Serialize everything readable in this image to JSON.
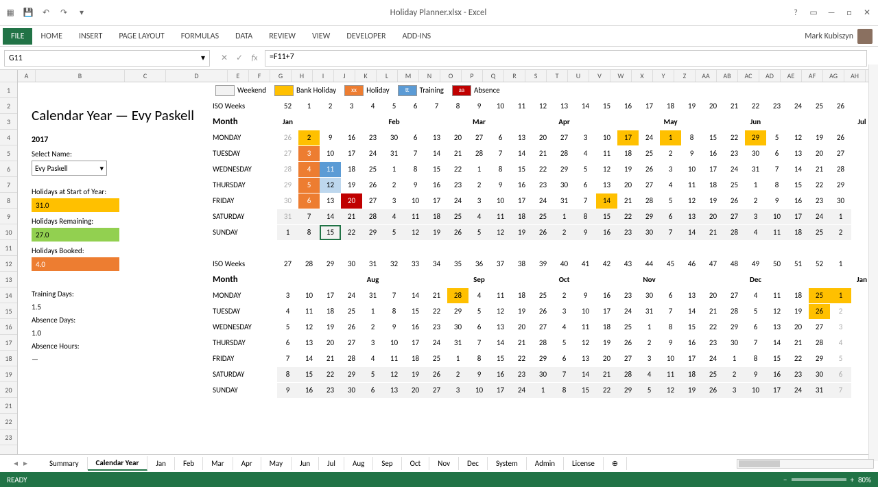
{
  "app": {
    "title": "Holiday Planner.xlsx - Excel"
  },
  "user": {
    "name": "Mark Kubiszyn"
  },
  "ribbon": [
    "FILE",
    "HOME",
    "INSERT",
    "PAGE LAYOUT",
    "FORMULAS",
    "DATA",
    "REVIEW",
    "VIEW",
    "DEVELOPER",
    "ADD-INS"
  ],
  "name_box": "G11",
  "formula": "=F11+7",
  "legend": {
    "weekend": "Weekend",
    "bank": "Bank Holiday",
    "holiday": "Holiday",
    "training": "Training",
    "absence": "Absence",
    "xx": "xx",
    "tt": "tt",
    "aa": "aa"
  },
  "sidebar": {
    "title": "Calendar Year — Evy Paskell",
    "year": "2017",
    "select_label": "Select Name:",
    "select_value": "Evy Paskell",
    "holidays_start_label": "Holidays at Start of Year:",
    "holidays_start": "31.0",
    "holidays_remaining_label": "Holidays Remaining:",
    "holidays_remaining": "27.0",
    "holidays_booked_label": "Holidays Booked:",
    "holidays_booked": "4.0",
    "training_label": "Training Days:",
    "training": "1.5",
    "absence_days_label": "Absence Days:",
    "absence_days": "1.0",
    "absence_hours_label": "Absence Hours:",
    "absence_hours": "—"
  },
  "iso_label": "ISO Weeks",
  "month_label": "Month",
  "months1": {
    "Jan": 0,
    "Feb": 5,
    "Mar": 9,
    "Apr": 13,
    "May": 18,
    "Jun": 22,
    "Jul": 27
  },
  "months2": {
    "Aug": 4,
    "Sep": 9,
    "Oct": 13,
    "Nov": 17,
    "Dec": 22,
    "Jan": 27
  },
  "iso1": [
    "52",
    "1",
    "2",
    "3",
    "4",
    "5",
    "6",
    "7",
    "8",
    "9",
    "10",
    "11",
    "12",
    "13",
    "14",
    "15",
    "16",
    "17",
    "18",
    "19",
    "20",
    "21",
    "22",
    "23",
    "24",
    "25",
    "26"
  ],
  "iso2": [
    "27",
    "28",
    "29",
    "30",
    "31",
    "32",
    "33",
    "34",
    "35",
    "36",
    "37",
    "38",
    "39",
    "40",
    "41",
    "42",
    "43",
    "44",
    "45",
    "46",
    "47",
    "48",
    "49",
    "50",
    "51",
    "52",
    "1"
  ],
  "days": [
    "MONDAY",
    "TUESDAY",
    "WEDNESDAY",
    "THURSDAY",
    "FRIDAY",
    "SATURDAY",
    "SUNDAY"
  ],
  "block1": [
    [
      [
        "26",
        "gray"
      ],
      [
        "2",
        "hol-yellow"
      ],
      [
        "9",
        ""
      ],
      [
        "16",
        ""
      ],
      [
        "23",
        ""
      ],
      [
        "30",
        ""
      ],
      [
        "6",
        ""
      ],
      [
        "13",
        ""
      ],
      [
        "20",
        ""
      ],
      [
        "27",
        ""
      ],
      [
        "6",
        ""
      ],
      [
        "13",
        ""
      ],
      [
        "20",
        ""
      ],
      [
        "27",
        ""
      ],
      [
        "3",
        ""
      ],
      [
        "10",
        ""
      ],
      [
        "17",
        "hol-yellow"
      ],
      [
        "24",
        ""
      ],
      [
        "1",
        "hol-yellow"
      ],
      [
        "8",
        ""
      ],
      [
        "15",
        ""
      ],
      [
        "22",
        ""
      ],
      [
        "29",
        "hol-yellow"
      ],
      [
        "5",
        ""
      ],
      [
        "12",
        ""
      ],
      [
        "19",
        ""
      ],
      [
        "26",
        ""
      ]
    ],
    [
      [
        "27",
        "gray"
      ],
      [
        "3",
        "hol-orange"
      ],
      [
        "10",
        ""
      ],
      [
        "17",
        ""
      ],
      [
        "24",
        ""
      ],
      [
        "31",
        ""
      ],
      [
        "7",
        ""
      ],
      [
        "14",
        ""
      ],
      [
        "21",
        ""
      ],
      [
        "28",
        ""
      ],
      [
        "7",
        ""
      ],
      [
        "14",
        ""
      ],
      [
        "21",
        ""
      ],
      [
        "28",
        ""
      ],
      [
        "4",
        ""
      ],
      [
        "11",
        ""
      ],
      [
        "18",
        ""
      ],
      [
        "25",
        ""
      ],
      [
        "2",
        ""
      ],
      [
        "9",
        ""
      ],
      [
        "16",
        ""
      ],
      [
        "23",
        ""
      ],
      [
        "30",
        ""
      ],
      [
        "6",
        ""
      ],
      [
        "13",
        ""
      ],
      [
        "20",
        ""
      ],
      [
        "27",
        ""
      ]
    ],
    [
      [
        "28",
        "gray"
      ],
      [
        "4",
        "hol-orange"
      ],
      [
        "11",
        "hol-blue"
      ],
      [
        "18",
        ""
      ],
      [
        "25",
        ""
      ],
      [
        "1",
        ""
      ],
      [
        "8",
        ""
      ],
      [
        "15",
        ""
      ],
      [
        "22",
        ""
      ],
      [
        "1",
        ""
      ],
      [
        "8",
        ""
      ],
      [
        "15",
        ""
      ],
      [
        "22",
        ""
      ],
      [
        "29",
        ""
      ],
      [
        "5",
        ""
      ],
      [
        "12",
        ""
      ],
      [
        "19",
        ""
      ],
      [
        "26",
        ""
      ],
      [
        "3",
        ""
      ],
      [
        "10",
        ""
      ],
      [
        "17",
        ""
      ],
      [
        "24",
        ""
      ],
      [
        "31",
        ""
      ],
      [
        "7",
        ""
      ],
      [
        "14",
        ""
      ],
      [
        "21",
        ""
      ],
      [
        "28",
        ""
      ]
    ],
    [
      [
        "29",
        "gray"
      ],
      [
        "5",
        "hol-orange"
      ],
      [
        "12",
        "hol-lblue"
      ],
      [
        "19",
        ""
      ],
      [
        "26",
        ""
      ],
      [
        "2",
        ""
      ],
      [
        "9",
        ""
      ],
      [
        "16",
        ""
      ],
      [
        "23",
        ""
      ],
      [
        "2",
        ""
      ],
      [
        "9",
        ""
      ],
      [
        "16",
        ""
      ],
      [
        "23",
        ""
      ],
      [
        "30",
        ""
      ],
      [
        "6",
        ""
      ],
      [
        "13",
        ""
      ],
      [
        "20",
        ""
      ],
      [
        "27",
        ""
      ],
      [
        "4",
        ""
      ],
      [
        "11",
        ""
      ],
      [
        "18",
        ""
      ],
      [
        "25",
        ""
      ],
      [
        "1",
        ""
      ],
      [
        "8",
        ""
      ],
      [
        "15",
        ""
      ],
      [
        "22",
        ""
      ],
      [
        "29",
        ""
      ]
    ],
    [
      [
        "30",
        "gray"
      ],
      [
        "6",
        "hol-orange"
      ],
      [
        "13",
        ""
      ],
      [
        "20",
        "hol-red"
      ],
      [
        "27",
        ""
      ],
      [
        "3",
        ""
      ],
      [
        "10",
        ""
      ],
      [
        "17",
        ""
      ],
      [
        "24",
        ""
      ],
      [
        "3",
        ""
      ],
      [
        "10",
        ""
      ],
      [
        "17",
        ""
      ],
      [
        "24",
        ""
      ],
      [
        "31",
        ""
      ],
      [
        "7",
        ""
      ],
      [
        "14",
        "hol-yellow"
      ],
      [
        "21",
        ""
      ],
      [
        "28",
        ""
      ],
      [
        "5",
        ""
      ],
      [
        "12",
        ""
      ],
      [
        "19",
        ""
      ],
      [
        "26",
        ""
      ],
      [
        "2",
        ""
      ],
      [
        "9",
        ""
      ],
      [
        "16",
        ""
      ],
      [
        "23",
        ""
      ],
      [
        "30",
        ""
      ]
    ],
    [
      [
        "31",
        "gray weekend"
      ],
      [
        "7",
        "weekend"
      ],
      [
        "14",
        "weekend"
      ],
      [
        "21",
        "weekend"
      ],
      [
        "28",
        "weekend"
      ],
      [
        "4",
        "weekend"
      ],
      [
        "11",
        "weekend"
      ],
      [
        "18",
        "weekend"
      ],
      [
        "25",
        "weekend"
      ],
      [
        "4",
        "weekend"
      ],
      [
        "11",
        "weekend"
      ],
      [
        "18",
        "weekend"
      ],
      [
        "25",
        "weekend"
      ],
      [
        "1",
        "weekend"
      ],
      [
        "8",
        "weekend"
      ],
      [
        "15",
        "weekend"
      ],
      [
        "22",
        "weekend"
      ],
      [
        "29",
        "weekend"
      ],
      [
        "6",
        "weekend"
      ],
      [
        "13",
        "weekend"
      ],
      [
        "20",
        "weekend"
      ],
      [
        "27",
        "weekend"
      ],
      [
        "3",
        "weekend"
      ],
      [
        "10",
        "weekend"
      ],
      [
        "17",
        "weekend"
      ],
      [
        "24",
        "weekend"
      ],
      [
        "1",
        "weekend"
      ]
    ],
    [
      [
        "1",
        "weekend"
      ],
      [
        "8",
        "weekend"
      ],
      [
        "15",
        "weekend selected"
      ],
      [
        "22",
        "weekend"
      ],
      [
        "29",
        "weekend"
      ],
      [
        "5",
        "weekend"
      ],
      [
        "12",
        "weekend"
      ],
      [
        "19",
        "weekend"
      ],
      [
        "26",
        "weekend"
      ],
      [
        "5",
        "weekend"
      ],
      [
        "12",
        "weekend"
      ],
      [
        "19",
        "weekend"
      ],
      [
        "26",
        "weekend"
      ],
      [
        "2",
        "weekend"
      ],
      [
        "9",
        "weekend"
      ],
      [
        "16",
        "weekend"
      ],
      [
        "23",
        "weekend"
      ],
      [
        "30",
        "weekend"
      ],
      [
        "7",
        "weekend"
      ],
      [
        "14",
        "weekend"
      ],
      [
        "21",
        "weekend"
      ],
      [
        "28",
        "weekend"
      ],
      [
        "4",
        "weekend"
      ],
      [
        "11",
        "weekend"
      ],
      [
        "18",
        "weekend"
      ],
      [
        "25",
        "weekend"
      ],
      [
        "2",
        "weekend"
      ]
    ]
  ],
  "block2": [
    [
      [
        "3",
        ""
      ],
      [
        "10",
        ""
      ],
      [
        "17",
        ""
      ],
      [
        "24",
        ""
      ],
      [
        "31",
        ""
      ],
      [
        "7",
        ""
      ],
      [
        "14",
        ""
      ],
      [
        "21",
        ""
      ],
      [
        "28",
        "hol-yellow"
      ],
      [
        "4",
        ""
      ],
      [
        "11",
        ""
      ],
      [
        "18",
        ""
      ],
      [
        "25",
        ""
      ],
      [
        "2",
        ""
      ],
      [
        "9",
        ""
      ],
      [
        "16",
        ""
      ],
      [
        "23",
        ""
      ],
      [
        "30",
        ""
      ],
      [
        "6",
        ""
      ],
      [
        "13",
        ""
      ],
      [
        "20",
        ""
      ],
      [
        "27",
        ""
      ],
      [
        "4",
        ""
      ],
      [
        "11",
        ""
      ],
      [
        "18",
        ""
      ],
      [
        "25",
        "hol-yellow"
      ],
      [
        "1",
        "hol-yellow"
      ]
    ],
    [
      [
        "4",
        ""
      ],
      [
        "11",
        ""
      ],
      [
        "18",
        ""
      ],
      [
        "25",
        ""
      ],
      [
        "1",
        ""
      ],
      [
        "8",
        ""
      ],
      [
        "15",
        ""
      ],
      [
        "22",
        ""
      ],
      [
        "29",
        ""
      ],
      [
        "5",
        ""
      ],
      [
        "12",
        ""
      ],
      [
        "19",
        ""
      ],
      [
        "26",
        ""
      ],
      [
        "3",
        ""
      ],
      [
        "10",
        ""
      ],
      [
        "17",
        ""
      ],
      [
        "24",
        ""
      ],
      [
        "31",
        ""
      ],
      [
        "7",
        ""
      ],
      [
        "14",
        ""
      ],
      [
        "21",
        ""
      ],
      [
        "28",
        ""
      ],
      [
        "5",
        ""
      ],
      [
        "12",
        ""
      ],
      [
        "19",
        ""
      ],
      [
        "26",
        "hol-yellow"
      ],
      [
        "2",
        "gray"
      ]
    ],
    [
      [
        "5",
        ""
      ],
      [
        "12",
        ""
      ],
      [
        "19",
        ""
      ],
      [
        "26",
        ""
      ],
      [
        "2",
        ""
      ],
      [
        "9",
        ""
      ],
      [
        "16",
        ""
      ],
      [
        "23",
        ""
      ],
      [
        "30",
        ""
      ],
      [
        "6",
        ""
      ],
      [
        "13",
        ""
      ],
      [
        "20",
        ""
      ],
      [
        "27",
        ""
      ],
      [
        "4",
        ""
      ],
      [
        "11",
        ""
      ],
      [
        "18",
        ""
      ],
      [
        "25",
        ""
      ],
      [
        "1",
        ""
      ],
      [
        "8",
        ""
      ],
      [
        "15",
        ""
      ],
      [
        "22",
        ""
      ],
      [
        "29",
        ""
      ],
      [
        "6",
        ""
      ],
      [
        "13",
        ""
      ],
      [
        "20",
        ""
      ],
      [
        "27",
        ""
      ],
      [
        "3",
        "gray"
      ]
    ],
    [
      [
        "6",
        ""
      ],
      [
        "13",
        ""
      ],
      [
        "20",
        ""
      ],
      [
        "27",
        ""
      ],
      [
        "3",
        ""
      ],
      [
        "10",
        ""
      ],
      [
        "17",
        ""
      ],
      [
        "24",
        ""
      ],
      [
        "31",
        ""
      ],
      [
        "7",
        ""
      ],
      [
        "14",
        ""
      ],
      [
        "21",
        ""
      ],
      [
        "28",
        ""
      ],
      [
        "5",
        ""
      ],
      [
        "12",
        ""
      ],
      [
        "19",
        ""
      ],
      [
        "26",
        ""
      ],
      [
        "2",
        ""
      ],
      [
        "9",
        ""
      ],
      [
        "16",
        ""
      ],
      [
        "23",
        ""
      ],
      [
        "30",
        ""
      ],
      [
        "7",
        ""
      ],
      [
        "14",
        ""
      ],
      [
        "21",
        ""
      ],
      [
        "28",
        ""
      ],
      [
        "4",
        "gray"
      ]
    ],
    [
      [
        "7",
        ""
      ],
      [
        "14",
        ""
      ],
      [
        "21",
        ""
      ],
      [
        "28",
        ""
      ],
      [
        "4",
        ""
      ],
      [
        "11",
        ""
      ],
      [
        "18",
        ""
      ],
      [
        "25",
        ""
      ],
      [
        "1",
        ""
      ],
      [
        "8",
        ""
      ],
      [
        "15",
        ""
      ],
      [
        "22",
        ""
      ],
      [
        "29",
        ""
      ],
      [
        "6",
        ""
      ],
      [
        "13",
        ""
      ],
      [
        "20",
        ""
      ],
      [
        "27",
        ""
      ],
      [
        "3",
        ""
      ],
      [
        "10",
        ""
      ],
      [
        "17",
        ""
      ],
      [
        "24",
        ""
      ],
      [
        "1",
        ""
      ],
      [
        "8",
        ""
      ],
      [
        "15",
        ""
      ],
      [
        "22",
        ""
      ],
      [
        "29",
        ""
      ],
      [
        "5",
        "gray"
      ]
    ],
    [
      [
        "8",
        "weekend"
      ],
      [
        "15",
        "weekend"
      ],
      [
        "22",
        "weekend"
      ],
      [
        "29",
        "weekend"
      ],
      [
        "5",
        "weekend"
      ],
      [
        "12",
        "weekend"
      ],
      [
        "19",
        "weekend"
      ],
      [
        "26",
        "weekend"
      ],
      [
        "2",
        "weekend"
      ],
      [
        "9",
        "weekend"
      ],
      [
        "16",
        "weekend"
      ],
      [
        "23",
        "weekend"
      ],
      [
        "30",
        "weekend"
      ],
      [
        "7",
        "weekend"
      ],
      [
        "14",
        "weekend"
      ],
      [
        "21",
        "weekend"
      ],
      [
        "28",
        "weekend"
      ],
      [
        "4",
        "weekend"
      ],
      [
        "11",
        "weekend"
      ],
      [
        "18",
        "weekend"
      ],
      [
        "25",
        "weekend"
      ],
      [
        "2",
        "weekend"
      ],
      [
        "9",
        "weekend"
      ],
      [
        "16",
        "weekend"
      ],
      [
        "23",
        "weekend"
      ],
      [
        "30",
        "weekend"
      ],
      [
        "6",
        "gray weekend"
      ]
    ],
    [
      [
        "9",
        "weekend"
      ],
      [
        "16",
        "weekend"
      ],
      [
        "23",
        "weekend"
      ],
      [
        "30",
        "weekend"
      ],
      [
        "6",
        "weekend"
      ],
      [
        "13",
        "weekend"
      ],
      [
        "20",
        "weekend"
      ],
      [
        "27",
        "weekend"
      ],
      [
        "3",
        "weekend"
      ],
      [
        "10",
        "weekend"
      ],
      [
        "17",
        "weekend"
      ],
      [
        "24",
        "weekend"
      ],
      [
        "1",
        "weekend"
      ],
      [
        "8",
        "weekend"
      ],
      [
        "15",
        "weekend"
      ],
      [
        "22",
        "weekend"
      ],
      [
        "29",
        "weekend"
      ],
      [
        "5",
        "weekend"
      ],
      [
        "12",
        "weekend"
      ],
      [
        "19",
        "weekend"
      ],
      [
        "26",
        "weekend"
      ],
      [
        "3",
        "weekend"
      ],
      [
        "10",
        "weekend"
      ],
      [
        "17",
        "weekend"
      ],
      [
        "24",
        "weekend"
      ],
      [
        "31",
        "weekend"
      ],
      [
        "7",
        "gray weekend"
      ]
    ]
  ],
  "sheet_tabs": [
    "Summary",
    "Calendar Year",
    "Jan",
    "Feb",
    "Mar",
    "Apr",
    "May",
    "Jun",
    "Jul",
    "Aug",
    "Sep",
    "Oct",
    "Nov",
    "Dec",
    "System",
    "Admin",
    "License"
  ],
  "active_tab": "Calendar Year",
  "status": "READY",
  "zoom": "80%",
  "col_letters": [
    "A",
    "B",
    "C",
    "D",
    "E",
    "F",
    "G",
    "H",
    "I",
    "J",
    "K",
    "L",
    "M",
    "N",
    "O",
    "P",
    "Q",
    "R",
    "S",
    "T",
    "U",
    "V",
    "W",
    "X",
    "Y",
    "Z",
    "AA",
    "AB",
    "AC",
    "AD",
    "AE",
    "AF",
    "AG",
    "AH"
  ]
}
